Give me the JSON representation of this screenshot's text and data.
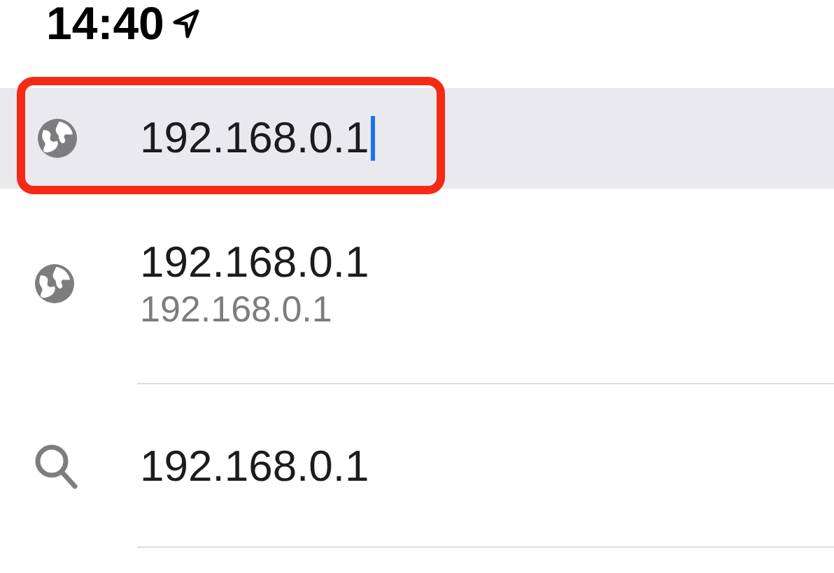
{
  "status_bar": {
    "time": "14:40"
  },
  "address_bar": {
    "value": "192.168.0.1",
    "focused": true,
    "highlighted": true
  },
  "suggestions": [
    {
      "kind": "site",
      "title": "192.168.0.1",
      "subtitle": "192.168.0.1"
    },
    {
      "kind": "search",
      "title": "192.168.0.1"
    }
  ]
}
